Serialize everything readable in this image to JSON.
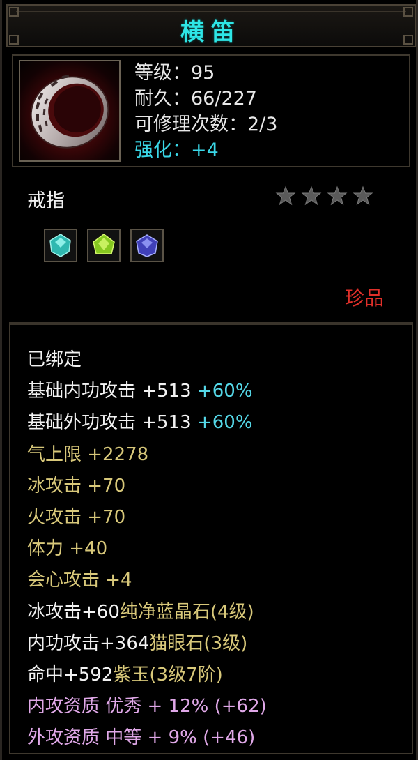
{
  "item": {
    "name": "横笛",
    "stats": [
      {
        "text": "等级：95",
        "color": "white"
      },
      {
        "text": "耐久：66/227",
        "color": "white"
      },
      {
        "text": "可修理次数：2/3",
        "color": "white"
      },
      {
        "text": "强化：+4",
        "color": "cyan"
      }
    ],
    "type": "戒指",
    "stars": 4,
    "gems": [
      "cyan-crystal-gem-icon",
      "green-crystal-gem-icon",
      "blue-crystal-gem-icon"
    ],
    "rarity": "珍品"
  },
  "colors": {
    "title": "#2ee6e6",
    "rarity": "#e0302a",
    "attribute_gold": "#d8c87a",
    "attribute_white": "#f2f2f2",
    "attribute_cyan": "#55d8e8",
    "attribute_pink": "#e0a8e8"
  },
  "attributes": {
    "bound": "已绑定",
    "lines": [
      {
        "parts": [
          {
            "t": "基础内功攻击 +513 ",
            "c": "white"
          },
          {
            "t": "+60%",
            "c": "cyan2"
          }
        ]
      },
      {
        "parts": [
          {
            "t": "基础外功攻击 +513 ",
            "c": "white"
          },
          {
            "t": "+60%",
            "c": "cyan2"
          }
        ]
      },
      {
        "parts": [
          {
            "t": "气上限 +2278",
            "c": "gold"
          }
        ]
      },
      {
        "parts": [
          {
            "t": "冰攻击 +70",
            "c": "gold"
          }
        ]
      },
      {
        "parts": [
          {
            "t": "火攻击 +70",
            "c": "gold"
          }
        ]
      },
      {
        "parts": [
          {
            "t": "体力 +40",
            "c": "gold"
          }
        ]
      },
      {
        "parts": [
          {
            "t": "会心攻击 +4",
            "c": "gold"
          }
        ]
      },
      {
        "parts": [
          {
            "t": "冰攻击+60",
            "c": "white"
          },
          {
            "t": "纯净蓝晶石(4级)",
            "c": "gold"
          }
        ]
      },
      {
        "parts": [
          {
            "t": "内功攻击+364",
            "c": "white"
          },
          {
            "t": "猫眼石(3级)",
            "c": "gold"
          }
        ]
      },
      {
        "parts": [
          {
            "t": "命中+592",
            "c": "white"
          },
          {
            "t": "紫玉(3级7阶)",
            "c": "gold"
          }
        ]
      },
      {
        "parts": [
          {
            "t": "内攻资质 优秀 + 12% (+62)",
            "c": "pink"
          }
        ]
      },
      {
        "parts": [
          {
            "t": "外攻资质 中等 + 9% (+46)",
            "c": "pink"
          }
        ]
      }
    ]
  }
}
